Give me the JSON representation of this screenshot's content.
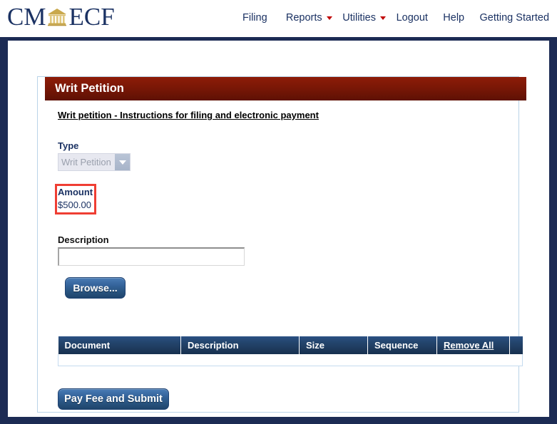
{
  "brand": {
    "logo_left": "CM",
    "logo_right": "ECF",
    "logo_icon": "courthouse-icon"
  },
  "nav": {
    "items": [
      {
        "label": "Filing",
        "has_dropdown": false
      },
      {
        "label": "Reports",
        "has_dropdown": true
      },
      {
        "label": "Utilities",
        "has_dropdown": true
      },
      {
        "label": "Logout",
        "has_dropdown": false
      },
      {
        "label": "Help",
        "has_dropdown": false
      },
      {
        "label": "Getting Started",
        "has_dropdown": false
      }
    ]
  },
  "card": {
    "title": "Writ Petition",
    "instructions_link": "Writ petition - Instructions for filing and electronic payment",
    "type": {
      "label": "Type",
      "selected": "Writ Petition"
    },
    "amount": {
      "label": "Amount",
      "value": "$500.00",
      "highlight_color": "#ef3e33"
    },
    "description": {
      "label": "Description",
      "value": "",
      "placeholder": ""
    },
    "browse_button": "Browse...",
    "submit_button": "Pay Fee and Submit"
  },
  "documents_table": {
    "headers": {
      "document": "Document",
      "description": "Description",
      "size": "Size",
      "sequence": "Sequence",
      "remove_all": "Remove All"
    },
    "rows": []
  },
  "colors": {
    "header_red": "#7a1706",
    "navy_frame": "#1c2b54",
    "brand_navy": "#1b3263",
    "table_navy": "#24466f",
    "button_blue": "#35649c"
  }
}
